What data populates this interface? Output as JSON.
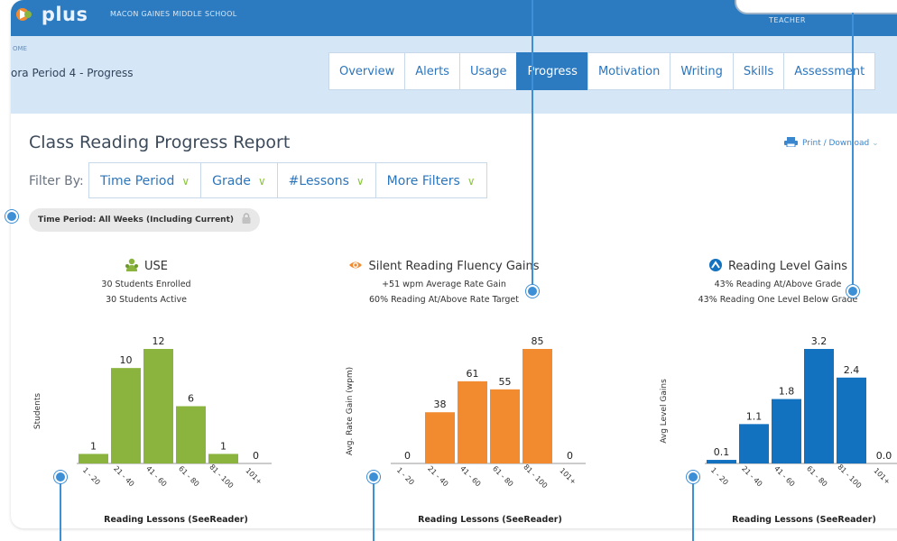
{
  "header": {
    "logo_text": "plus",
    "school": "MACON GAINES MIDDLE SCHOOL",
    "role": "TEACHER"
  },
  "breadcrumb": {
    "home": "OME",
    "title": "ora Period 4 - Progress"
  },
  "tabs": [
    {
      "label": "Overview",
      "active": false
    },
    {
      "label": "Alerts",
      "active": false
    },
    {
      "label": "Usage",
      "active": false
    },
    {
      "label": "Progress",
      "active": true
    },
    {
      "label": "Motivation",
      "active": false
    },
    {
      "label": "Writing",
      "active": false
    },
    {
      "label": "Skills",
      "active": false
    },
    {
      "label": "Assessment",
      "active": false
    }
  ],
  "report": {
    "title": "Class Reading Progress Report",
    "print_label": "Print / Download",
    "filter_label": "Filter By:",
    "filters": [
      "Time Period",
      "Grade",
      "#Lessons",
      "More Filters"
    ],
    "chip": "Time Period: All Weeks (Including Current)"
  },
  "sections": [
    {
      "title": "USE",
      "icon": "students-icon",
      "lines": [
        "30 Students Enrolled",
        "30 Students Active"
      ]
    },
    {
      "title": "Silent Reading Fluency Gains",
      "icon": "eye-icon",
      "lines": [
        "+51 wpm Average Rate Gain",
        "60% Reading At/Above Rate Target"
      ]
    },
    {
      "title": "Reading Level Gains",
      "icon": "level-icon",
      "lines": [
        "43% Reading At/Above Grade",
        "43% Reading One Level Below Grade"
      ]
    }
  ],
  "colors": {
    "accent": "#2c7bc1",
    "green": "#8ab43d",
    "orange": "#f28a30",
    "blue": "#1372c0",
    "callout": "#3d8fd6"
  },
  "chart_data": [
    {
      "type": "bar",
      "categories": [
        "1 - 20",
        "21 - 40",
        "41 - 60",
        "61 - 80",
        "81 - 100",
        "101+"
      ],
      "values": [
        1,
        10,
        12,
        6,
        1,
        0
      ],
      "labels": [
        "1",
        "10",
        "12",
        "6",
        "1",
        "0"
      ],
      "xlabel": "Reading Lessons (SeeReader)",
      "ylabel": "Students",
      "ylim": [
        0,
        12
      ],
      "color": "#8ab43d"
    },
    {
      "type": "bar",
      "categories": [
        "1 - 20",
        "21 - 40",
        "41 - 60",
        "61 - 80",
        "81 - 100",
        "101+"
      ],
      "values": [
        0,
        38,
        61,
        55,
        85,
        0
      ],
      "labels": [
        "0",
        "38",
        "61",
        "55",
        "85",
        "0"
      ],
      "xlabel": "Reading Lessons (SeeReader)",
      "ylabel": "Avg. Rate Gain (wpm)",
      "ylim": [
        0,
        85
      ],
      "color": "#f28a30"
    },
    {
      "type": "bar",
      "categories": [
        "1 - 20",
        "21 - 40",
        "41 - 60",
        "61 - 80",
        "81 - 100",
        "101+"
      ],
      "values": [
        0.1,
        1.1,
        1.8,
        3.2,
        2.4,
        0.0
      ],
      "labels": [
        "0.1",
        "1.1",
        "1.8",
        "3.2",
        "2.4",
        "0.0"
      ],
      "xlabel": "Reading Lessons (SeeReader)",
      "ylabel": "Avg Level Gains",
      "ylim": [
        0,
        3.2
      ],
      "color": "#1372c0"
    }
  ]
}
